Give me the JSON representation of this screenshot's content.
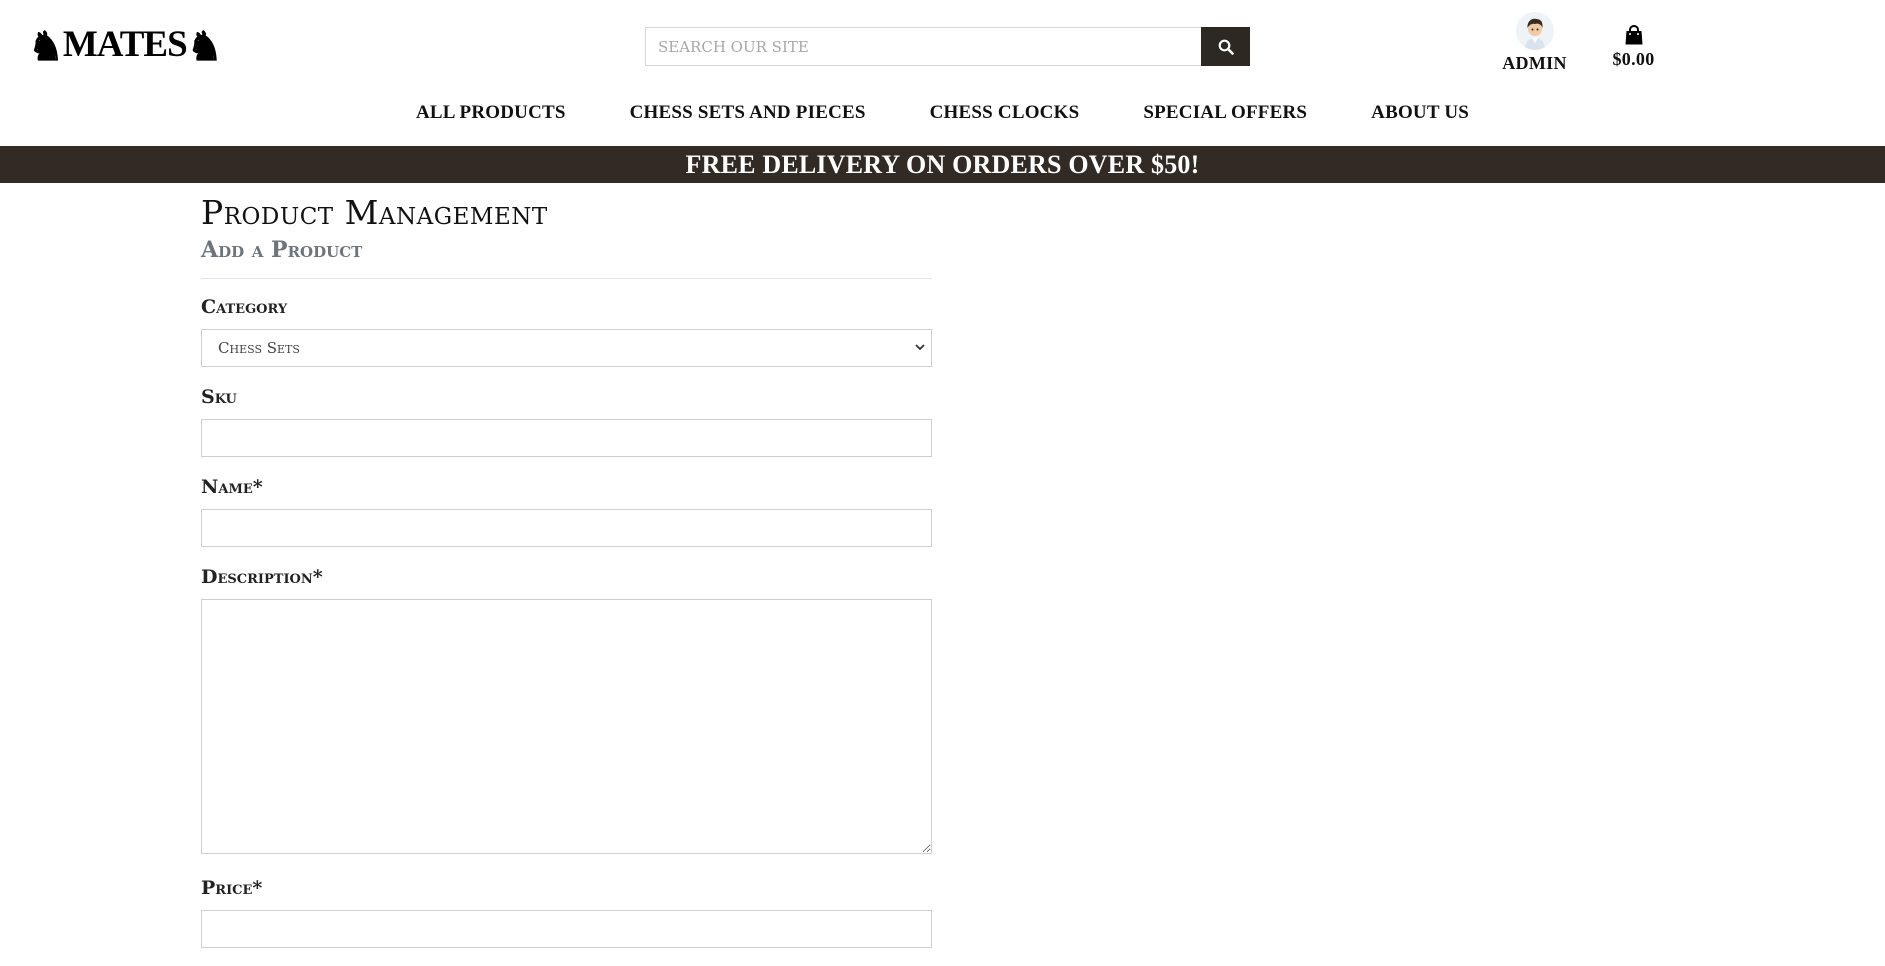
{
  "brand": {
    "logo_text": "MATES"
  },
  "search": {
    "placeholder": "Search our site"
  },
  "account": {
    "label": "ADMIN"
  },
  "bag": {
    "total": "$0.00"
  },
  "nav": {
    "items": [
      {
        "label": "ALL PRODUCTS"
      },
      {
        "label": "CHESS SETS AND PIECES"
      },
      {
        "label": "CHESS CLOCKS"
      },
      {
        "label": "SPECIAL OFFERS"
      },
      {
        "label": "ABOUT US"
      }
    ]
  },
  "banner": {
    "text": "FREE DELIVERY ON ORDERS OVER $50!"
  },
  "page": {
    "title": "Product Management",
    "subtitle": "Add a Product"
  },
  "form": {
    "category": {
      "label": "Category",
      "selected": "Chess Sets"
    },
    "sku": {
      "label": "Sku",
      "value": ""
    },
    "name": {
      "label": "Name*",
      "value": ""
    },
    "description": {
      "label": "Description*",
      "value": ""
    },
    "price": {
      "label": "Price*",
      "value": ""
    }
  },
  "colors": {
    "accent_dark": "#322a24",
    "search_button": "#2e2823",
    "muted_text": "#6c757d"
  }
}
